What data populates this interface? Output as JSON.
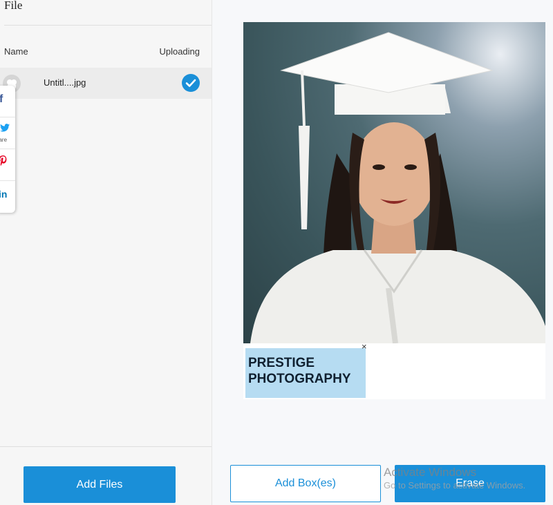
{
  "panel": {
    "title": "File",
    "columns": {
      "name": "Name",
      "status": "Uploading"
    },
    "files": [
      {
        "name": "Untitl....jpg",
        "status": "uploaded"
      }
    ]
  },
  "share": {
    "items": [
      {
        "network": "facebook",
        "glyph": "f",
        "color": "#3b5998"
      },
      {
        "network": "twitter",
        "glyph": "t",
        "label": "hare",
        "color": "#1da1f2"
      },
      {
        "network": "pinterest",
        "glyph": "p",
        "color": "#e60023"
      },
      {
        "network": "linkedin",
        "glyph": "in",
        "color": "#0077b5"
      }
    ]
  },
  "photo": {
    "caption": "PRESTIGE\nPHOTOGRAPHY",
    "close": "×"
  },
  "buttons": {
    "add_files": "Add Files",
    "add_boxes": "Add Box(es)",
    "erase": "Erase"
  },
  "watermark": {
    "title": "Activate Windows",
    "subtitle": "Go to Settings to activate Windows."
  }
}
